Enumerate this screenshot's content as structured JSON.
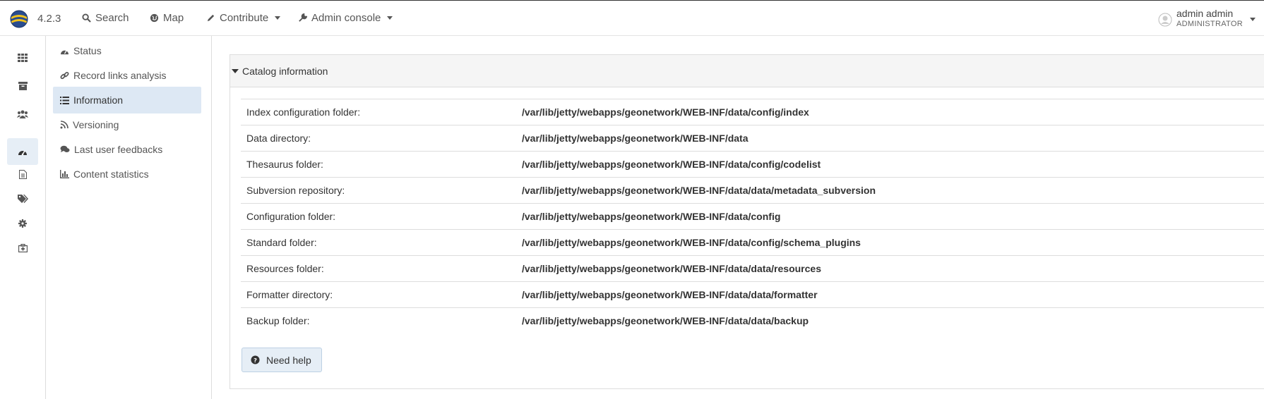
{
  "navbar": {
    "version": "4.2.3",
    "search_label": "Search",
    "map_label": "Map",
    "contribute_label": "Contribute",
    "admin_console_label": "Admin console",
    "user_name": "admin admin",
    "user_role": "ADMINISTRATOR"
  },
  "rail": {
    "items": [
      "grid-icon",
      "archive-icon",
      "users-icon",
      "cloud-download-icon",
      "dashboard-icon",
      "file-icon",
      "tags-icon",
      "gear-icon",
      "medkit-icon"
    ],
    "active_index": 4
  },
  "menu": {
    "items": [
      {
        "label": "Status",
        "icon": "dashboard-icon"
      },
      {
        "label": "Record links analysis",
        "icon": "link-icon"
      },
      {
        "label": "Information",
        "icon": "list-icon"
      },
      {
        "label": "Versioning",
        "icon": "rss-icon"
      },
      {
        "label": "Last user feedbacks",
        "icon": "comments-icon"
      },
      {
        "label": "Content statistics",
        "icon": "bar-chart-icon"
      }
    ],
    "active_index": 2
  },
  "panel": {
    "title": "Catalog information",
    "rows": [
      {
        "label": "Index configuration folder:",
        "value": "/var/lib/jetty/webapps/geonetwork/WEB-INF/data/config/index"
      },
      {
        "label": "Data directory:",
        "value": "/var/lib/jetty/webapps/geonetwork/WEB-INF/data"
      },
      {
        "label": "Thesaurus folder:",
        "value": "/var/lib/jetty/webapps/geonetwork/WEB-INF/data/config/codelist"
      },
      {
        "label": "Subversion repository:",
        "value": "/var/lib/jetty/webapps/geonetwork/WEB-INF/data/data/metadata_subversion"
      },
      {
        "label": "Configuration folder:",
        "value": "/var/lib/jetty/webapps/geonetwork/WEB-INF/data/config"
      },
      {
        "label": "Standard folder:",
        "value": "/var/lib/jetty/webapps/geonetwork/WEB-INF/data/config/schema_plugins"
      },
      {
        "label": "Resources folder:",
        "value": "/var/lib/jetty/webapps/geonetwork/WEB-INF/data/data/resources"
      },
      {
        "label": "Formatter directory:",
        "value": "/var/lib/jetty/webapps/geonetwork/WEB-INF/data/data/formatter"
      },
      {
        "label": "Backup folder:",
        "value": "/var/lib/jetty/webapps/geonetwork/WEB-INF/data/data/backup"
      }
    ],
    "help_label": "Need help"
  },
  "colors": {
    "active_bg": "#dde8f4",
    "icon_gray": "#555555"
  }
}
